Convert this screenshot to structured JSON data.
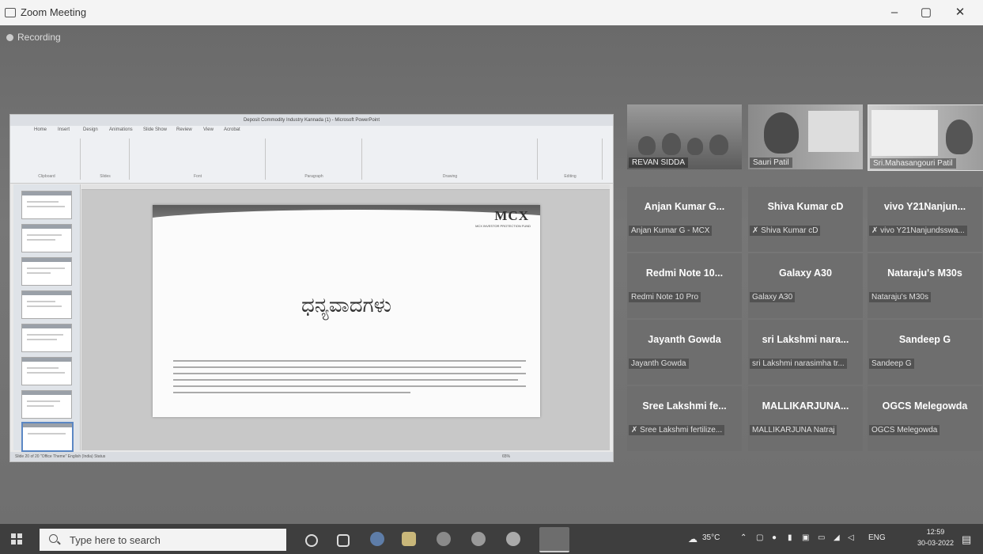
{
  "window": {
    "title": "Zoom Meeting",
    "min": "–",
    "max": "▢",
    "close": "✕"
  },
  "recording": "Recording",
  "shared_screen": {
    "app_title": "Deposit Commodity Industry Kannada (1) - Microsoft PowerPoint",
    "ribbon_tabs": [
      "Home",
      "Insert",
      "Design",
      "Animations",
      "Slide Show",
      "Review",
      "View",
      "Acrobat"
    ],
    "ribbon_groups": [
      "Clipboard",
      "Slides",
      "Font",
      "Paragraph",
      "Drawing",
      "Editing"
    ],
    "slide": {
      "logo": "MCX",
      "logo_sub": "MCX INVESTOR PROTECTION FUND",
      "heading": "ಧನ್ಯವಾದಗಳು"
    },
    "status_left": "Slide 20 of 20   \"Office Theme\"   English (India) Status",
    "status_right": "65%"
  },
  "video_tiles": [
    {
      "label": "REVAN SIDDA"
    },
    {
      "label": "Sauri Patil"
    },
    {
      "label": "Sri.Mahasangouri Patil"
    }
  ],
  "participants": [
    {
      "big": "Anjan Kumar G...",
      "small": "Anjan Kumar G - MCX",
      "muted": false
    },
    {
      "big": "Shiva Kumar cD",
      "small": "Shiva Kumar cD",
      "muted": true
    },
    {
      "big": "vivo Y21Nanjun...",
      "small": "vivo Y21Nanjundsswa...",
      "muted": true
    },
    {
      "big": "Redmi Note 10...",
      "small": "Redmi Note 10 Pro",
      "muted": false
    },
    {
      "big": "Galaxy A30",
      "small": "Galaxy A30",
      "muted": false
    },
    {
      "big": "Nataraju's M30s",
      "small": "Nataraju's M30s",
      "muted": false
    },
    {
      "big": "Jayanth Gowda",
      "small": "Jayanth Gowda",
      "muted": false
    },
    {
      "big": "sri Lakshmi nara...",
      "small": "sri Lakshmi narasimha tr...",
      "muted": false
    },
    {
      "big": "Sandeep G",
      "small": "Sandeep G",
      "muted": false
    },
    {
      "big": "Sree Lakshmi fe...",
      "small": "Sree Lakshmi fertilize...",
      "muted": true
    },
    {
      "big": "MALLIKARJUNA...",
      "small": "MALLIKARJUNA Natraj",
      "muted": false
    },
    {
      "big": "OGCS Melegowda",
      "small": "OGCS Melegowda",
      "muted": false
    }
  ],
  "taskbar": {
    "search_placeholder": "Type here to search",
    "weather": "35°C",
    "lang": "ENG",
    "time": "12:59",
    "date": "30-03-2022"
  }
}
